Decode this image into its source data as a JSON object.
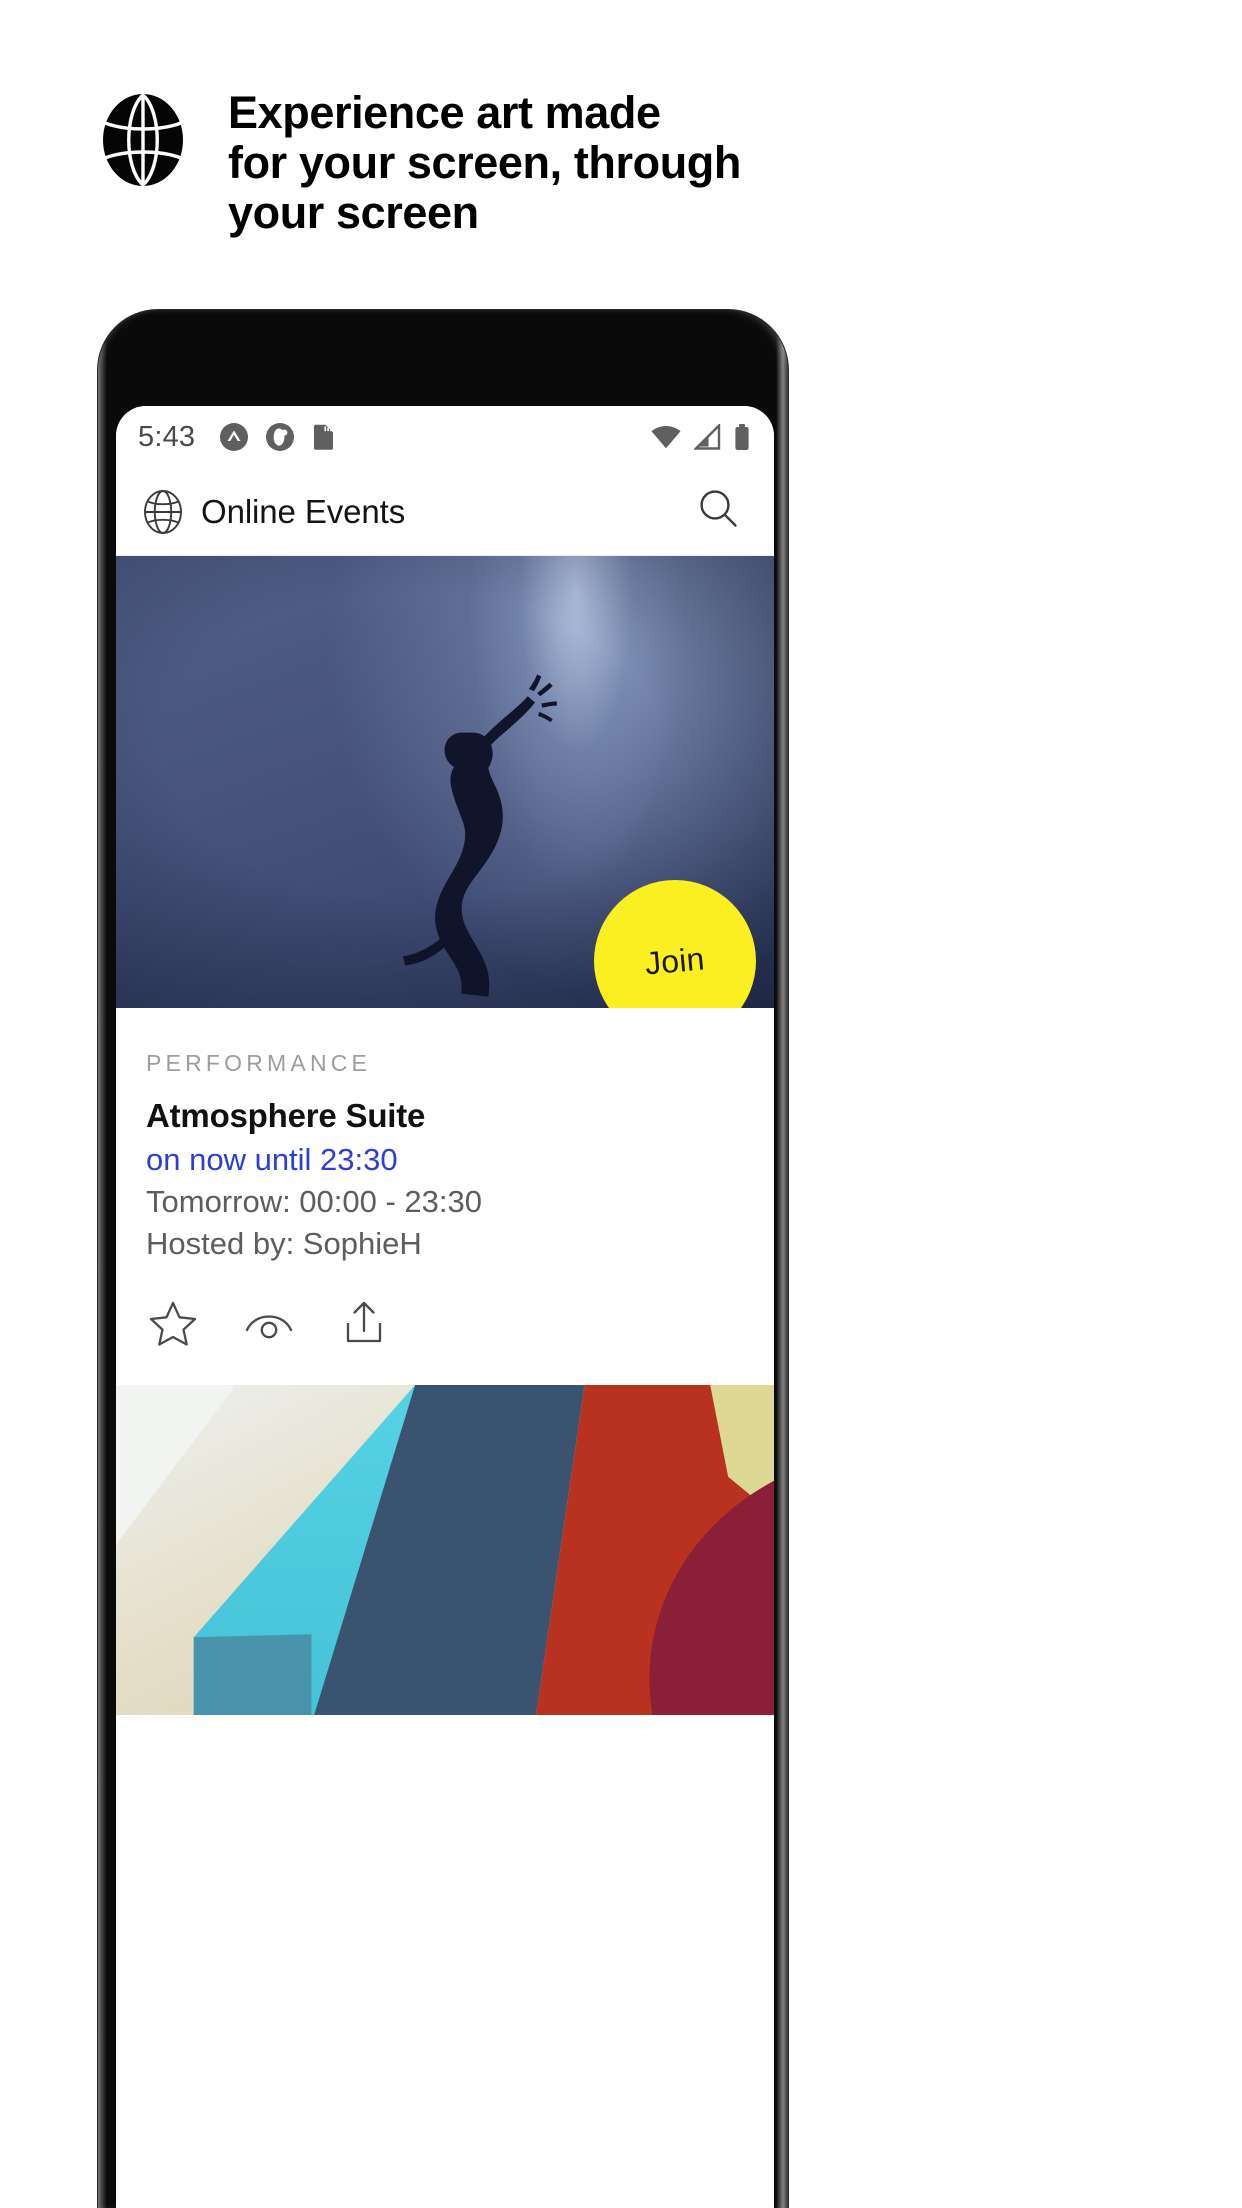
{
  "promo": {
    "logo_icon": "globe-filled-icon",
    "headline_lines": [
      "Experience art made",
      "for your screen, through",
      "your screen"
    ]
  },
  "phone": {
    "status_bar": {
      "time": "5:43",
      "left_icons": [
        "caret-circle-notification-icon",
        "clock-circle-notification-icon",
        "sd-card-icon"
      ],
      "right_icons": [
        "wifi-icon",
        "cellular-signal-icon",
        "battery-icon"
      ]
    },
    "app_bar": {
      "logo_icon": "globe-outline-icon",
      "title": "Online Events",
      "search_icon": "search-icon"
    },
    "hero": {
      "alt": "dancer-silhouette-blue",
      "join_label": "Join",
      "join_color": "#faf021"
    },
    "event_card": {
      "kicker": "PERFORMANCE",
      "title": "Atmosphere Suite",
      "live_text": "on now until 23:30",
      "live_color": "#2b3fd4",
      "schedule": "Tomorrow: 00:00 - 23:30",
      "host": "Hosted by: SophieH",
      "actions": [
        {
          "name": "favorite",
          "icon": "star-icon"
        },
        {
          "name": "watch",
          "icon": "eye-icon"
        },
        {
          "name": "share",
          "icon": "share-icon"
        }
      ]
    },
    "next_artwork": {
      "alt": "geometric-abstract-painting"
    }
  }
}
